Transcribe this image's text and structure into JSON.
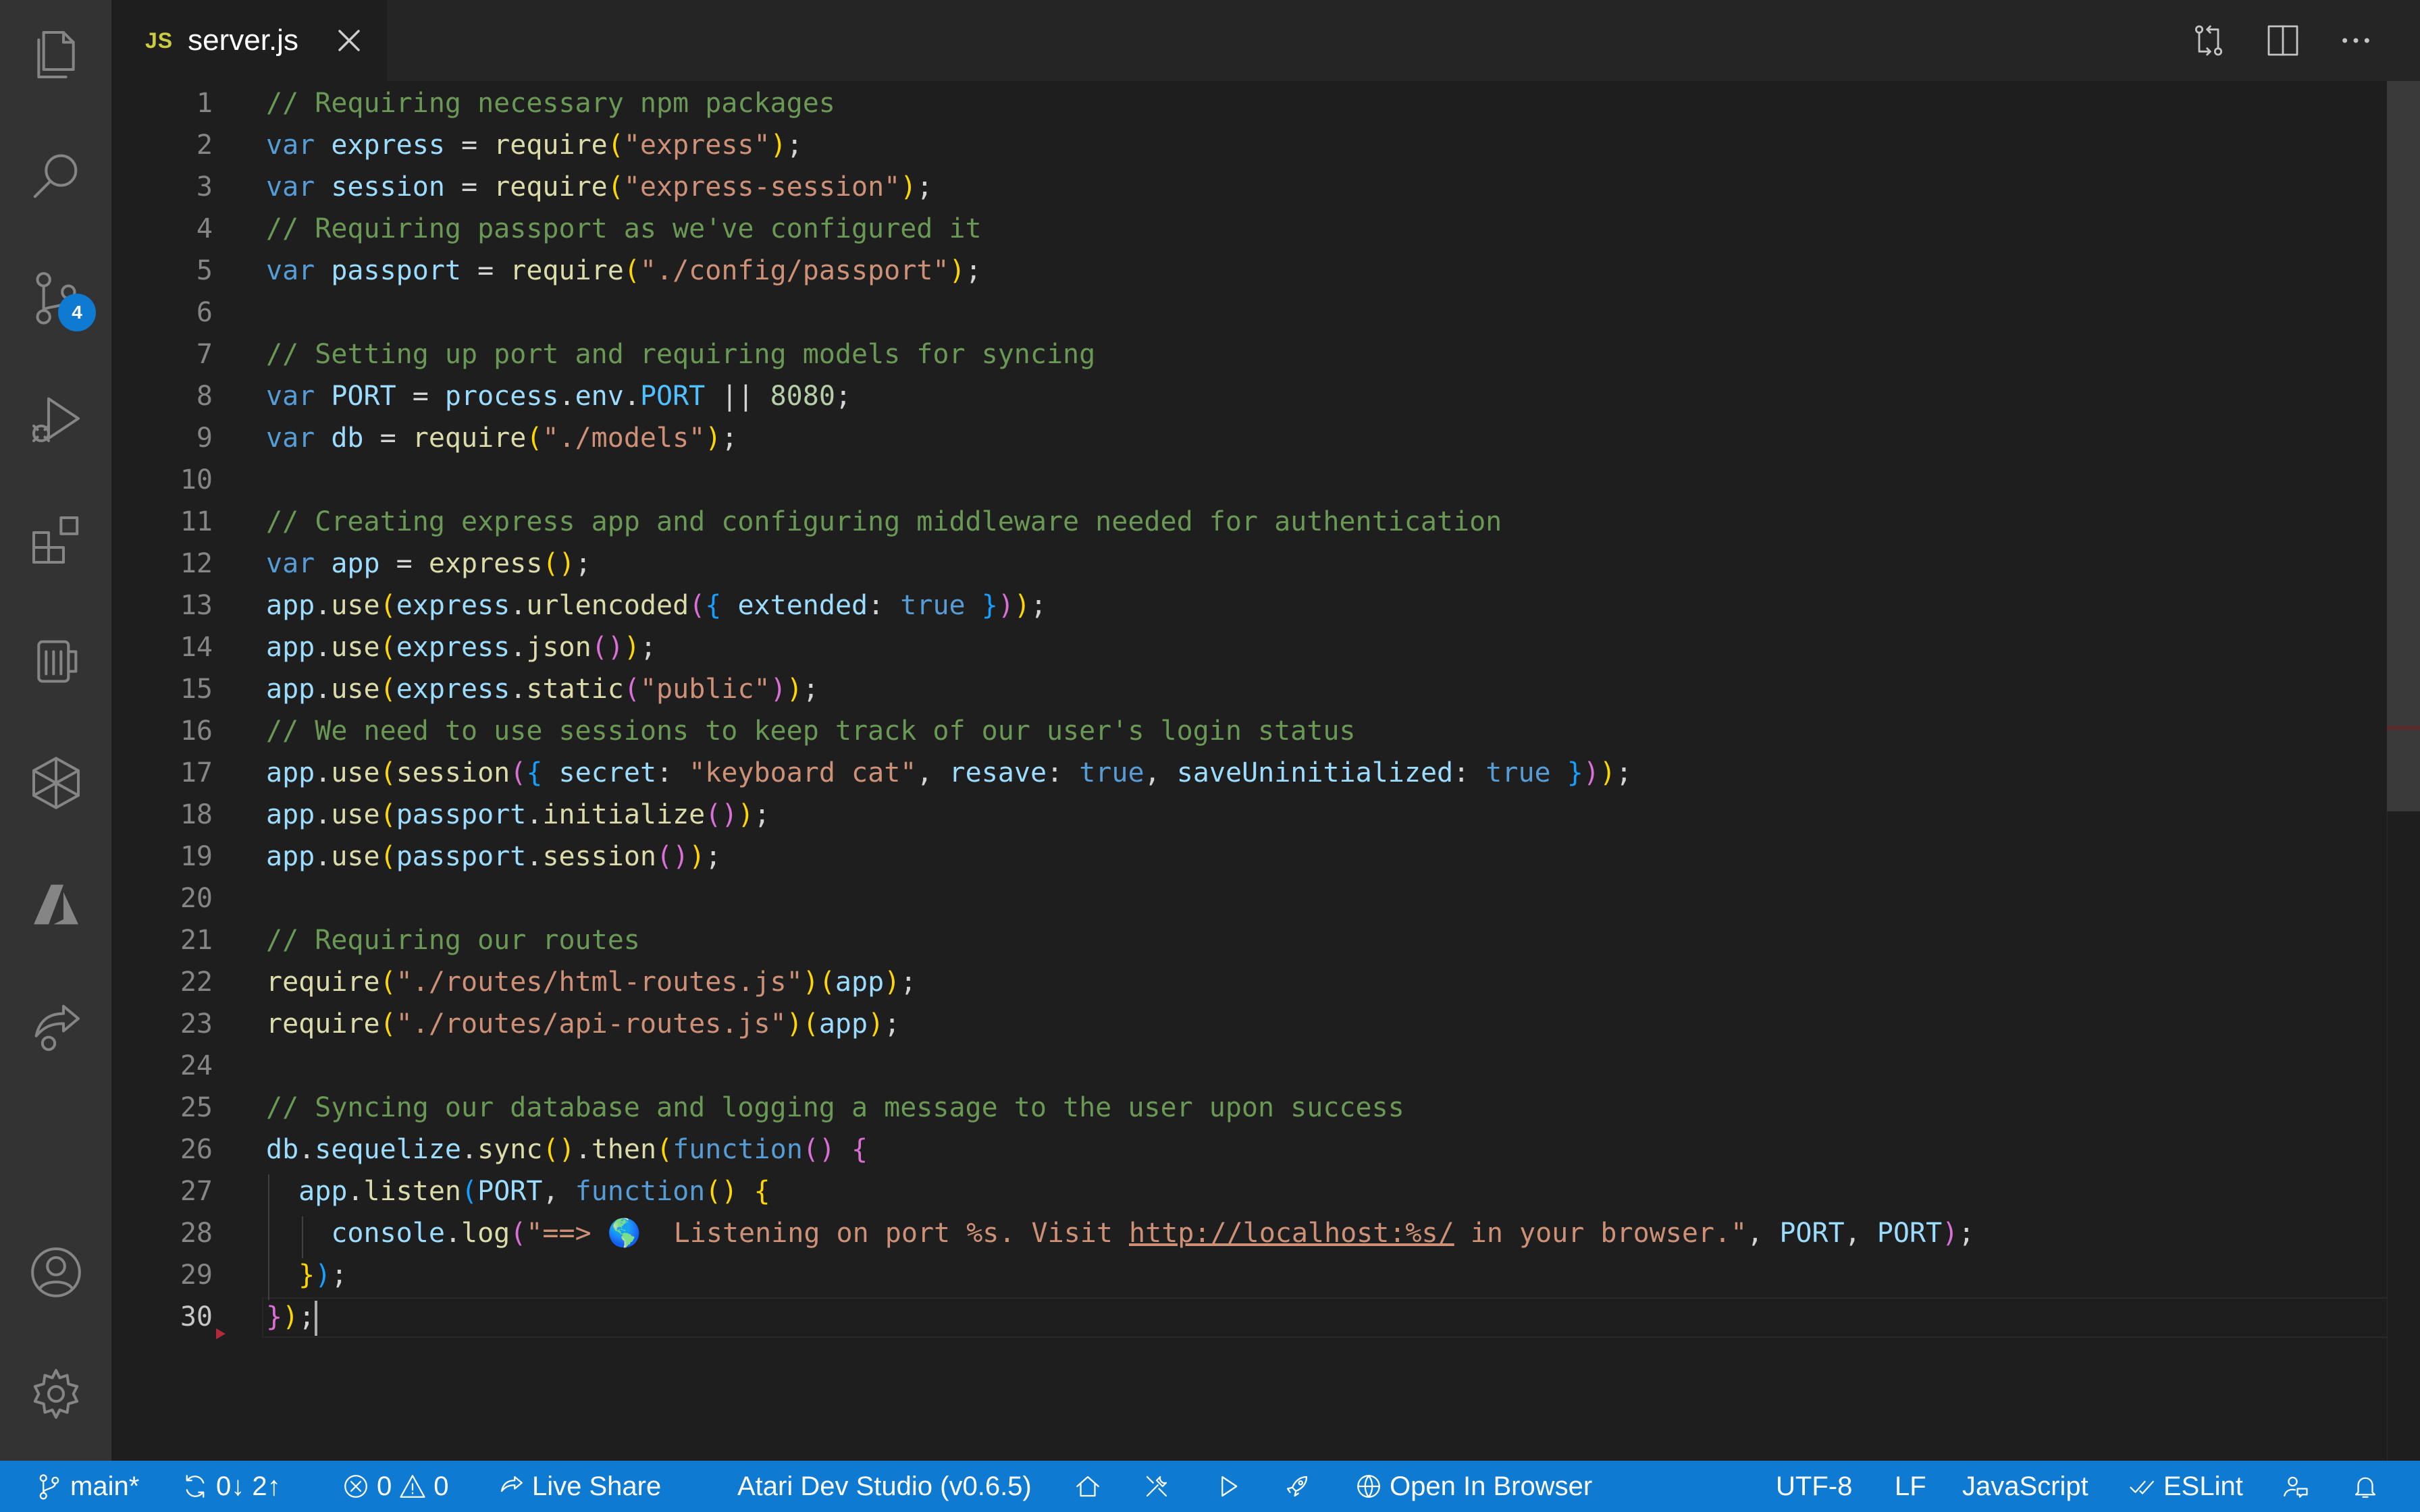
{
  "tab": {
    "language_badge": "JS",
    "filename": "server.js"
  },
  "activity_bar": {
    "source_control_badge": "4",
    "icons": [
      "explorer-icon",
      "search-icon",
      "source-control-icon",
      "run-debug-icon",
      "extensions-icon",
      "atari-dev-studio-icon",
      "package-icon",
      "azure-icon",
      "live-share-icon",
      "account-icon",
      "settings-icon"
    ]
  },
  "editor": {
    "line_numbers": [
      "1",
      "2",
      "3",
      "4",
      "5",
      "6",
      "7",
      "8",
      "9",
      "10",
      "11",
      "12",
      "13",
      "14",
      "15",
      "16",
      "17",
      "18",
      "19",
      "20",
      "21",
      "22",
      "23",
      "24",
      "25",
      "26",
      "27",
      "28",
      "29",
      "30"
    ],
    "lines": [
      [
        {
          "t": "// Requiring necessary npm packages",
          "c": "com"
        }
      ],
      [
        {
          "t": "var",
          "c": "kw"
        },
        {
          "t": " ",
          "c": "pl"
        },
        {
          "t": "express",
          "c": "var"
        },
        {
          "t": " = ",
          "c": "pl"
        },
        {
          "t": "require",
          "c": "fn"
        },
        {
          "t": "(",
          "c": "b1"
        },
        {
          "t": "\"express\"",
          "c": "str"
        },
        {
          "t": ")",
          "c": "b1"
        },
        {
          "t": ";",
          "c": "pl"
        }
      ],
      [
        {
          "t": "var",
          "c": "kw"
        },
        {
          "t": " ",
          "c": "pl"
        },
        {
          "t": "session",
          "c": "var"
        },
        {
          "t": " = ",
          "c": "pl"
        },
        {
          "t": "require",
          "c": "fn"
        },
        {
          "t": "(",
          "c": "b1"
        },
        {
          "t": "\"express-session\"",
          "c": "str"
        },
        {
          "t": ")",
          "c": "b1"
        },
        {
          "t": ";",
          "c": "pl"
        }
      ],
      [
        {
          "t": "// Requiring passport as we've configured it",
          "c": "com"
        }
      ],
      [
        {
          "t": "var",
          "c": "kw"
        },
        {
          "t": " ",
          "c": "pl"
        },
        {
          "t": "passport",
          "c": "var"
        },
        {
          "t": " = ",
          "c": "pl"
        },
        {
          "t": "require",
          "c": "fn"
        },
        {
          "t": "(",
          "c": "b1"
        },
        {
          "t": "\"./config/passport\"",
          "c": "str"
        },
        {
          "t": ")",
          "c": "b1"
        },
        {
          "t": ";",
          "c": "pl"
        }
      ],
      [],
      [
        {
          "t": "// Setting up port and requiring models for syncing",
          "c": "com"
        }
      ],
      [
        {
          "t": "var",
          "c": "kw"
        },
        {
          "t": " ",
          "c": "pl"
        },
        {
          "t": "PORT",
          "c": "var"
        },
        {
          "t": " = ",
          "c": "pl"
        },
        {
          "t": "process",
          "c": "var"
        },
        {
          "t": ".",
          "c": "pl"
        },
        {
          "t": "env",
          "c": "var"
        },
        {
          "t": ".",
          "c": "pl"
        },
        {
          "t": "PORT",
          "c": "const"
        },
        {
          "t": " || ",
          "c": "pl"
        },
        {
          "t": "8080",
          "c": "num"
        },
        {
          "t": ";",
          "c": "pl"
        }
      ],
      [
        {
          "t": "var",
          "c": "kw"
        },
        {
          "t": " ",
          "c": "pl"
        },
        {
          "t": "db",
          "c": "var"
        },
        {
          "t": " = ",
          "c": "pl"
        },
        {
          "t": "require",
          "c": "fn"
        },
        {
          "t": "(",
          "c": "b1"
        },
        {
          "t": "\"./models\"",
          "c": "str"
        },
        {
          "t": ")",
          "c": "b1"
        },
        {
          "t": ";",
          "c": "pl"
        }
      ],
      [],
      [
        {
          "t": "// Creating express app and configuring middleware needed for authentication",
          "c": "com"
        }
      ],
      [
        {
          "t": "var",
          "c": "kw"
        },
        {
          "t": " ",
          "c": "pl"
        },
        {
          "t": "app",
          "c": "var"
        },
        {
          "t": " = ",
          "c": "pl"
        },
        {
          "t": "express",
          "c": "fn"
        },
        {
          "t": "()",
          "c": "b1"
        },
        {
          "t": ";",
          "c": "pl"
        }
      ],
      [
        {
          "t": "app",
          "c": "var"
        },
        {
          "t": ".",
          "c": "pl"
        },
        {
          "t": "use",
          "c": "fn"
        },
        {
          "t": "(",
          "c": "b1"
        },
        {
          "t": "express",
          "c": "var"
        },
        {
          "t": ".",
          "c": "pl"
        },
        {
          "t": "urlencoded",
          "c": "fn"
        },
        {
          "t": "(",
          "c": "b2"
        },
        {
          "t": "{",
          "c": "b3"
        },
        {
          "t": " ",
          "c": "pl"
        },
        {
          "t": "extended",
          "c": "var"
        },
        {
          "t": ": ",
          "c": "pl"
        },
        {
          "t": "true",
          "c": "kw"
        },
        {
          "t": " ",
          "c": "pl"
        },
        {
          "t": "}",
          "c": "b3"
        },
        {
          "t": ")",
          "c": "b2"
        },
        {
          "t": ")",
          "c": "b1"
        },
        {
          "t": ";",
          "c": "pl"
        }
      ],
      [
        {
          "t": "app",
          "c": "var"
        },
        {
          "t": ".",
          "c": "pl"
        },
        {
          "t": "use",
          "c": "fn"
        },
        {
          "t": "(",
          "c": "b1"
        },
        {
          "t": "express",
          "c": "var"
        },
        {
          "t": ".",
          "c": "pl"
        },
        {
          "t": "json",
          "c": "fn"
        },
        {
          "t": "()",
          "c": "b2"
        },
        {
          "t": ")",
          "c": "b1"
        },
        {
          "t": ";",
          "c": "pl"
        }
      ],
      [
        {
          "t": "app",
          "c": "var"
        },
        {
          "t": ".",
          "c": "pl"
        },
        {
          "t": "use",
          "c": "fn"
        },
        {
          "t": "(",
          "c": "b1"
        },
        {
          "t": "express",
          "c": "var"
        },
        {
          "t": ".",
          "c": "pl"
        },
        {
          "t": "static",
          "c": "fn"
        },
        {
          "t": "(",
          "c": "b2"
        },
        {
          "t": "\"public\"",
          "c": "str"
        },
        {
          "t": ")",
          "c": "b2"
        },
        {
          "t": ")",
          "c": "b1"
        },
        {
          "t": ";",
          "c": "pl"
        }
      ],
      [
        {
          "t": "// We need to use sessions to keep track of our user's login status",
          "c": "com"
        }
      ],
      [
        {
          "t": "app",
          "c": "var"
        },
        {
          "t": ".",
          "c": "pl"
        },
        {
          "t": "use",
          "c": "fn"
        },
        {
          "t": "(",
          "c": "b1"
        },
        {
          "t": "session",
          "c": "fn"
        },
        {
          "t": "(",
          "c": "b2"
        },
        {
          "t": "{",
          "c": "b3"
        },
        {
          "t": " ",
          "c": "pl"
        },
        {
          "t": "secret",
          "c": "var"
        },
        {
          "t": ": ",
          "c": "pl"
        },
        {
          "t": "\"keyboard cat\"",
          "c": "str"
        },
        {
          "t": ", ",
          "c": "pl"
        },
        {
          "t": "resave",
          "c": "var"
        },
        {
          "t": ": ",
          "c": "pl"
        },
        {
          "t": "true",
          "c": "kw"
        },
        {
          "t": ", ",
          "c": "pl"
        },
        {
          "t": "saveUninitialized",
          "c": "var"
        },
        {
          "t": ": ",
          "c": "pl"
        },
        {
          "t": "true",
          "c": "kw"
        },
        {
          "t": " ",
          "c": "pl"
        },
        {
          "t": "}",
          "c": "b3"
        },
        {
          "t": ")",
          "c": "b2"
        },
        {
          "t": ")",
          "c": "b1"
        },
        {
          "t": ";",
          "c": "pl"
        }
      ],
      [
        {
          "t": "app",
          "c": "var"
        },
        {
          "t": ".",
          "c": "pl"
        },
        {
          "t": "use",
          "c": "fn"
        },
        {
          "t": "(",
          "c": "b1"
        },
        {
          "t": "passport",
          "c": "var"
        },
        {
          "t": ".",
          "c": "pl"
        },
        {
          "t": "initialize",
          "c": "fn"
        },
        {
          "t": "()",
          "c": "b2"
        },
        {
          "t": ")",
          "c": "b1"
        },
        {
          "t": ";",
          "c": "pl"
        }
      ],
      [
        {
          "t": "app",
          "c": "var"
        },
        {
          "t": ".",
          "c": "pl"
        },
        {
          "t": "use",
          "c": "fn"
        },
        {
          "t": "(",
          "c": "b1"
        },
        {
          "t": "passport",
          "c": "var"
        },
        {
          "t": ".",
          "c": "pl"
        },
        {
          "t": "session",
          "c": "fn"
        },
        {
          "t": "()",
          "c": "b2"
        },
        {
          "t": ")",
          "c": "b1"
        },
        {
          "t": ";",
          "c": "pl"
        }
      ],
      [],
      [
        {
          "t": "// Requiring our routes",
          "c": "com"
        }
      ],
      [
        {
          "t": "require",
          "c": "fn"
        },
        {
          "t": "(",
          "c": "b1"
        },
        {
          "t": "\"./routes/html-routes.js\"",
          "c": "str"
        },
        {
          "t": ")",
          "c": "b1"
        },
        {
          "t": "(",
          "c": "b1"
        },
        {
          "t": "app",
          "c": "var"
        },
        {
          "t": ")",
          "c": "b1"
        },
        {
          "t": ";",
          "c": "pl"
        }
      ],
      [
        {
          "t": "require",
          "c": "fn"
        },
        {
          "t": "(",
          "c": "b1"
        },
        {
          "t": "\"./routes/api-routes.js\"",
          "c": "str"
        },
        {
          "t": ")",
          "c": "b1"
        },
        {
          "t": "(",
          "c": "b1"
        },
        {
          "t": "app",
          "c": "var"
        },
        {
          "t": ")",
          "c": "b1"
        },
        {
          "t": ";",
          "c": "pl"
        }
      ],
      [],
      [
        {
          "t": "// Syncing our database and logging a message to the user upon success",
          "c": "com"
        }
      ],
      [
        {
          "t": "db",
          "c": "var"
        },
        {
          "t": ".",
          "c": "pl"
        },
        {
          "t": "sequelize",
          "c": "var"
        },
        {
          "t": ".",
          "c": "pl"
        },
        {
          "t": "sync",
          "c": "fn"
        },
        {
          "t": "()",
          "c": "b1"
        },
        {
          "t": ".",
          "c": "pl"
        },
        {
          "t": "then",
          "c": "fn"
        },
        {
          "t": "(",
          "c": "b1"
        },
        {
          "t": "function",
          "c": "kw"
        },
        {
          "t": "()",
          "c": "b2"
        },
        {
          "t": " ",
          "c": "pl"
        },
        {
          "t": "{",
          "c": "b2"
        }
      ],
      [
        {
          "t": "  ",
          "c": "pl"
        },
        {
          "t": "app",
          "c": "var"
        },
        {
          "t": ".",
          "c": "pl"
        },
        {
          "t": "listen",
          "c": "fn"
        },
        {
          "t": "(",
          "c": "b3"
        },
        {
          "t": "PORT",
          "c": "var"
        },
        {
          "t": ", ",
          "c": "pl"
        },
        {
          "t": "function",
          "c": "kw"
        },
        {
          "t": "()",
          "c": "b1"
        },
        {
          "t": " ",
          "c": "pl"
        },
        {
          "t": "{",
          "c": "b1"
        }
      ],
      [
        {
          "t": "    ",
          "c": "pl"
        },
        {
          "t": "console",
          "c": "var"
        },
        {
          "t": ".",
          "c": "pl"
        },
        {
          "t": "log",
          "c": "fn"
        },
        {
          "t": "(",
          "c": "b2"
        },
        {
          "t": "\"==> 🌎  Listening on port %s. Visit ",
          "c": "str"
        },
        {
          "t": "http://localhost:%s/",
          "c": "link"
        },
        {
          "t": " in your browser.\"",
          "c": "str"
        },
        {
          "t": ", ",
          "c": "pl"
        },
        {
          "t": "PORT",
          "c": "var"
        },
        {
          "t": ", ",
          "c": "pl"
        },
        {
          "t": "PORT",
          "c": "var"
        },
        {
          "t": ")",
          "c": "b2"
        },
        {
          "t": ";",
          "c": "pl"
        }
      ],
      [
        {
          "t": "  ",
          "c": "pl"
        },
        {
          "t": "}",
          "c": "b1"
        },
        {
          "t": ")",
          "c": "b3"
        },
        {
          "t": ";",
          "c": "pl"
        }
      ],
      [
        {
          "t": "}",
          "c": "b2"
        },
        {
          "t": ")",
          "c": "b1"
        },
        {
          "t": ";",
          "c": "pl"
        }
      ]
    ]
  },
  "status_bar": {
    "branch": "main*",
    "sync": "0↓ 2↑",
    "errors": "0",
    "warnings": "0",
    "live_share": "Live Share",
    "atari": "Atari Dev Studio (v0.6.5)",
    "open_in_browser": "Open In Browser",
    "encoding": "UTF-8",
    "eol": "LF",
    "language": "JavaScript",
    "eslint": "ESLint"
  },
  "colors": {
    "status_bar_bg": "#0e7ad1",
    "activity_bar_bg": "#333333",
    "editor_bg": "#1e1e1e",
    "badge_bg": "#0e7ad1"
  }
}
